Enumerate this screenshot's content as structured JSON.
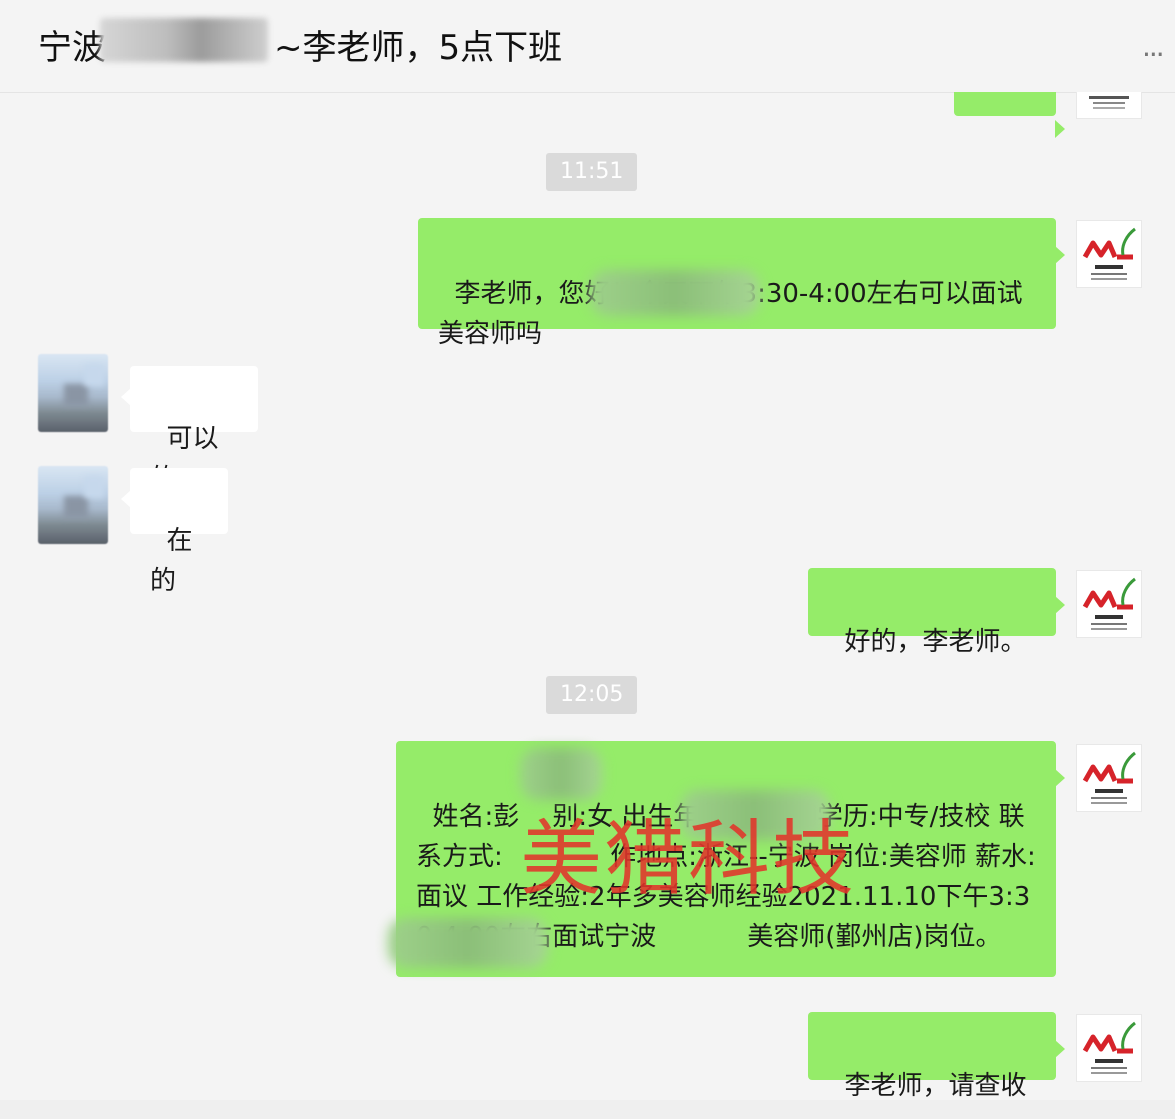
{
  "header": {
    "title": "宁波xxxxxx~李老师，5点下班",
    "title_prefix": "宁波",
    "title_suffix": "~李老师，5点下班",
    "more_label": "..."
  },
  "watermark": "美猎科技",
  "avatar_me_text": "ML",
  "messages": [
    {
      "type": "time",
      "text": "11:51"
    },
    {
      "type": "msg",
      "from": "me",
      "text": "李老师，您好！今天下午3:30-4:00左右可以面试美容师吗"
    },
    {
      "type": "msg",
      "from": "other",
      "text": "可以的"
    },
    {
      "type": "msg",
      "from": "other",
      "text": "在的"
    },
    {
      "type": "msg",
      "from": "me",
      "text": "好的，李老师。"
    },
    {
      "type": "time",
      "text": "12:05"
    },
    {
      "type": "msg",
      "from": "me",
      "text": "姓名:彭    别:女 出生年份: 2001 学历:中专/技校 联系方式:             作地点:浙江--宁波 岗位:美容师 薪水:面议 工作经验:2年多美容师经验2021.11.10下午3:30-4:00左右面试宁波           美容师(鄞州店)岗位。"
    },
    {
      "type": "msg",
      "from": "me",
      "text": "李老师，请查收"
    }
  ],
  "colors": {
    "my_bubble": "#95ec69",
    "other_bubble": "#ffffff",
    "background": "#f4f4f4",
    "watermark": "#e2352b",
    "logo_red": "#d6232a",
    "logo_green": "#3a9a3a"
  }
}
